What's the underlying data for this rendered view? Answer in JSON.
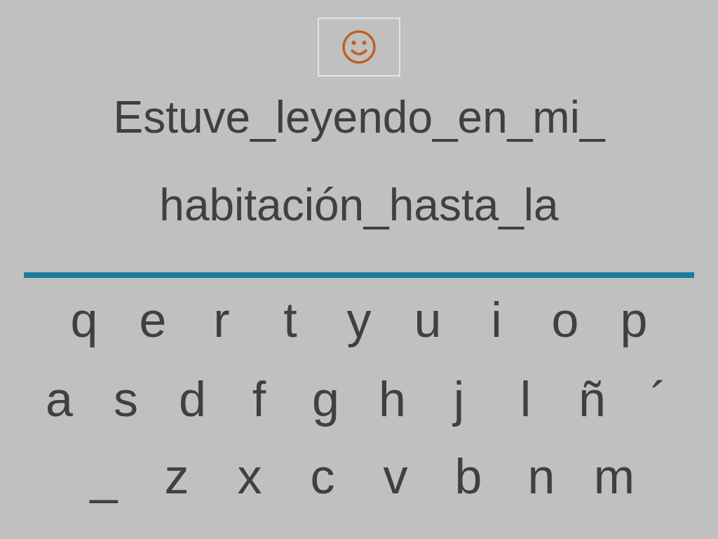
{
  "phrase_lines": [
    "Estuve_leyendo_en_mi_",
    "habitación_hasta_la"
  ],
  "keyboard_rows": [
    [
      "q",
      "e",
      "r",
      "t",
      "y",
      "u",
      "i",
      "o",
      "p"
    ],
    [
      "a",
      "s",
      "d",
      "f",
      "g",
      "h",
      "j",
      "l",
      "ñ",
      "´"
    ],
    [
      "_",
      "z",
      "x",
      "c",
      "v",
      "b",
      "n",
      "m"
    ]
  ]
}
